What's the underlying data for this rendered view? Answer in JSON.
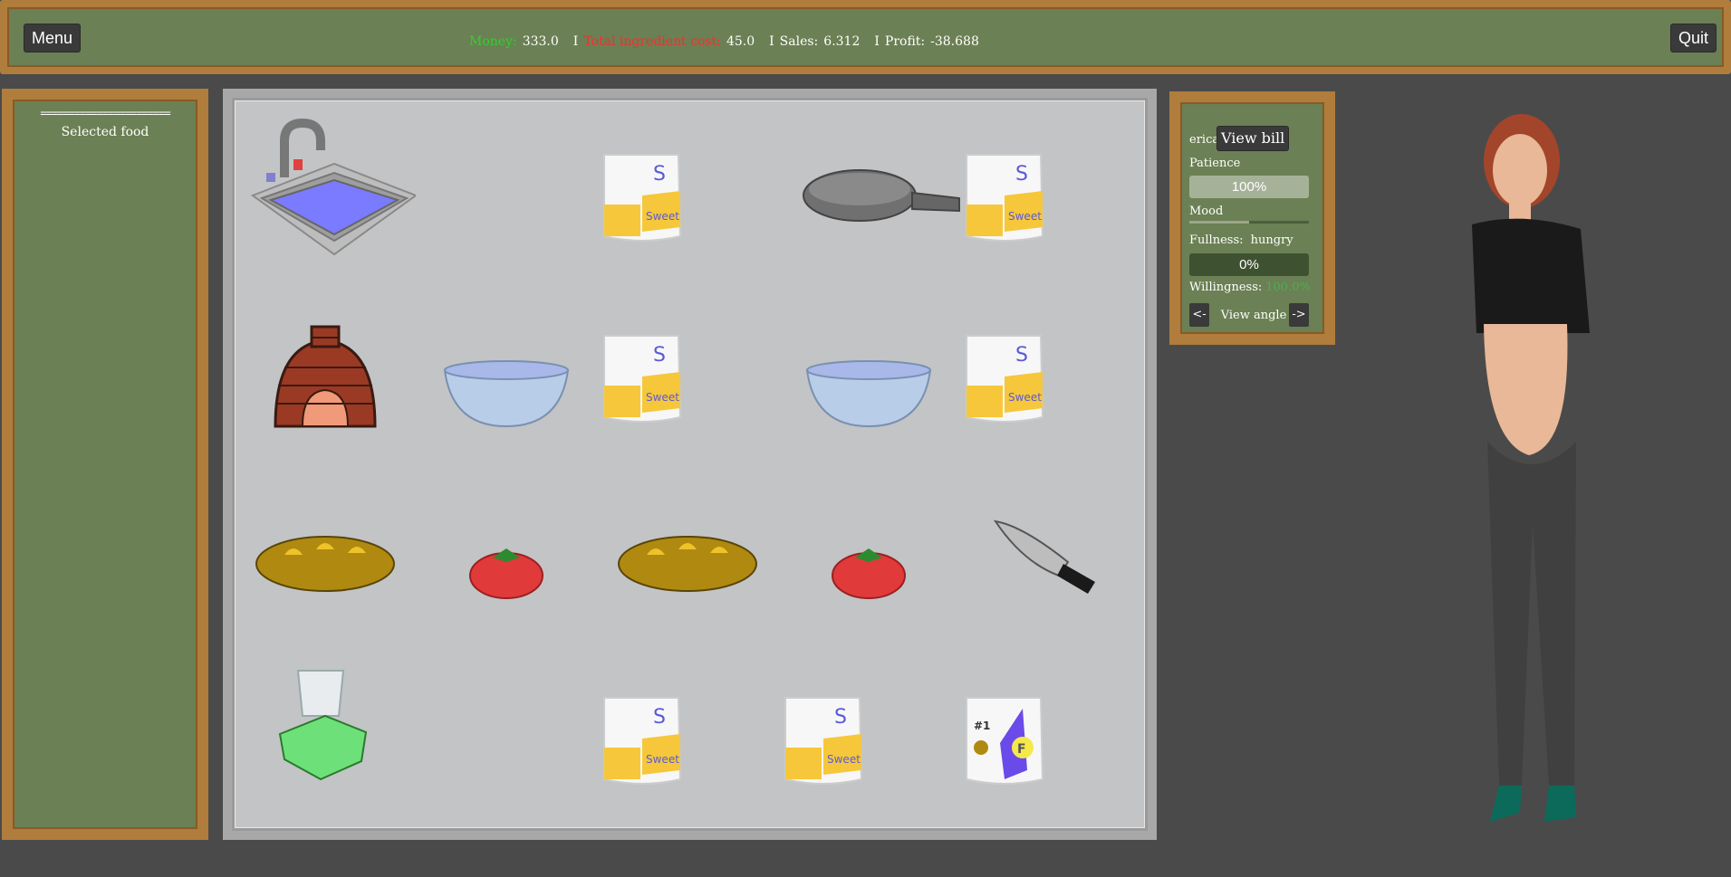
{
  "topbar": {
    "menu_label": "Menu",
    "quit_label": "Quit",
    "money_label": "Money:",
    "money_value": "333.0",
    "cost_label": "Total ingredient cost:",
    "cost_value": "45.0",
    "sales_label": "Sales:",
    "sales_value": "6.312",
    "profit_label": "Profit:",
    "profit_value": "-38.688",
    "separator": "I"
  },
  "left_panel": {
    "dashes": "=======================",
    "selected_food_label": "Selected food"
  },
  "kitchen": {
    "items": [
      {
        "name": "sink",
        "icon": "sink-icon"
      },
      {
        "name": "sugar-bag",
        "icon": "sugar-bag-icon",
        "bag_text": "Sweet"
      },
      {
        "name": "frying-pan",
        "icon": "frying-pan-icon"
      },
      {
        "name": "sugar-bag",
        "icon": "sugar-bag-icon",
        "bag_text": "Sweet"
      },
      {
        "name": "brick-oven",
        "icon": "brick-oven-icon"
      },
      {
        "name": "mixing-bowl",
        "icon": "bowl-icon"
      },
      {
        "name": "sugar-bag",
        "icon": "sugar-bag-icon",
        "bag_text": "Sweet"
      },
      {
        "name": "mixing-bowl",
        "icon": "bowl-icon"
      },
      {
        "name": "sugar-bag",
        "icon": "sugar-bag-icon",
        "bag_text": "Sweet"
      },
      {
        "name": "bread-loaf",
        "icon": "bread-icon"
      },
      {
        "name": "tomato",
        "icon": "tomato-icon"
      },
      {
        "name": "bread-loaf",
        "icon": "bread-icon"
      },
      {
        "name": "tomato",
        "icon": "tomato-icon"
      },
      {
        "name": "knife",
        "icon": "knife-icon"
      },
      {
        "name": "blender",
        "icon": "blender-icon"
      },
      {
        "name": "sugar-bag",
        "icon": "sugar-bag-icon",
        "bag_text": "Sweet"
      },
      {
        "name": "sugar-bag",
        "icon": "sugar-bag-icon",
        "bag_text": "Sweet"
      },
      {
        "name": "flour-bag",
        "icon": "flour-bag-icon",
        "bag_text": "F",
        "bag_number": "#1"
      }
    ]
  },
  "customer": {
    "name": "erica",
    "view_bill_label": "View bill",
    "patience_label": "Patience",
    "patience_value": "100%",
    "patience_fraction": 1.0,
    "mood_label": "Mood",
    "mood_fraction": 0.5,
    "fullness_label": "Fullness:",
    "fullness_state": "hungry",
    "fullness_value": "0%",
    "fullness_fraction": 0.0,
    "willingness_label": "Willingness:",
    "willingness_value": "100.0%",
    "prev_angle_label": "<-",
    "next_angle_label": "->",
    "view_angle_label": "View angle"
  },
  "colors": {
    "panel_green": "#6b8054",
    "wood_frame": "#b07d3c",
    "money_green": "#2ed12e",
    "cost_red": "#ff2a2a",
    "willingness_green": "#4caf50"
  }
}
